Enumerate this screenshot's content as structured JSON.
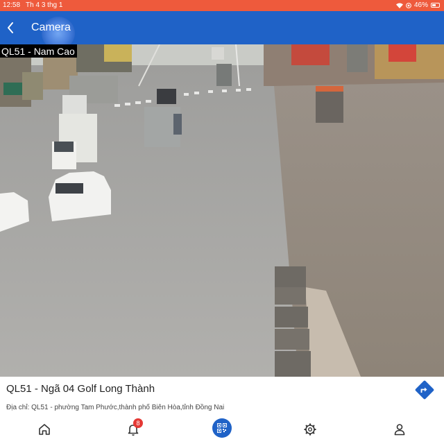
{
  "status_bar": {
    "time": "12:58",
    "date": "Th 4 3 thg 1",
    "battery": "46%"
  },
  "app_bar": {
    "title": "Camera"
  },
  "camera": {
    "overlay_label": "QL51 - Nam Cao"
  },
  "info": {
    "name": "QL51 - Ngã 04 Golf Long Thành",
    "address": "Địa chỉ: QL51 - phường Tam Phước,thành phố Biên Hòa,tỉnh Đồng Nai"
  },
  "bottom_nav": {
    "notification_count": "8",
    "items": [
      "home-icon",
      "bell-icon",
      "qr-code-icon",
      "gear-icon",
      "person-icon"
    ]
  },
  "colors": {
    "status_bar": "#ee5a3c",
    "app_bar": "#1f62c7",
    "accent": "#1f62c7",
    "badge": "#e53935"
  }
}
